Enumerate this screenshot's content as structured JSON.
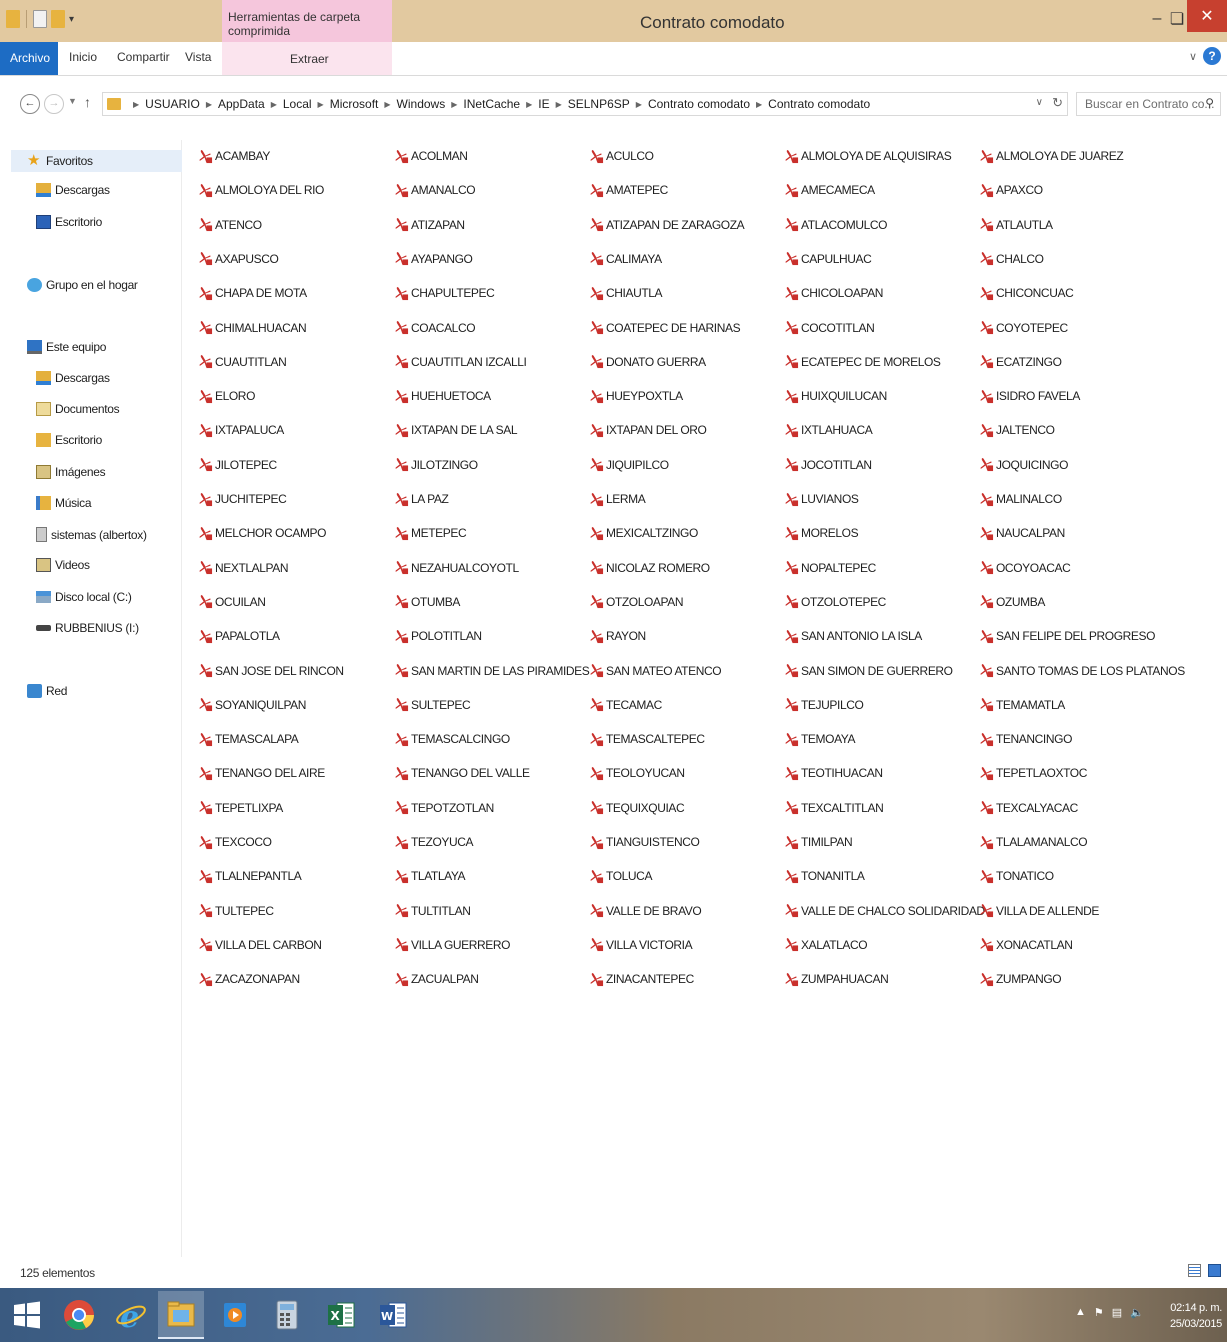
{
  "window": {
    "title": "Contrato comodato",
    "context_tab_header": "Herramientas de carpeta comprimida"
  },
  "ribbon": {
    "tabs": [
      "Archivo",
      "Inicio",
      "Compartir",
      "Vista"
    ],
    "context_tab": "Extraer"
  },
  "address": {
    "breadcrumbs": [
      "USUARIO",
      "AppData",
      "Local",
      "Microsoft",
      "Windows",
      "INetCache",
      "IE",
      "SELNP6SP",
      "Contrato comodato",
      "Contrato comodato"
    ],
    "search_placeholder": "Buscar en Contrato co..."
  },
  "navpane": {
    "favorites": "Favoritos",
    "fav_items": [
      "Descargas",
      "Escritorio"
    ],
    "homegroup": "Grupo en el hogar",
    "thispc": "Este equipo",
    "pc_items": [
      "Descargas",
      "Documentos",
      "Escritorio",
      "Imágenes",
      "Música",
      "sistemas (albertox)",
      "Videos",
      "Disco local (C:)",
      "RUBBENIUS (I:)"
    ],
    "network": "Red"
  },
  "files": [
    "ACAMBAY",
    "ACOLMAN",
    "ACULCO",
    "ALMOLOYA DE ALQUISIRAS",
    "ALMOLOYA DE JUAREZ",
    "ALMOLOYA DEL RIO",
    "AMANALCO",
    "AMATEPEC",
    "AMECAMECA",
    "APAXCO",
    "ATENCO",
    "ATIZAPAN",
    "ATIZAPAN DE ZARAGOZA",
    "ATLACOMULCO",
    "ATLAUTLA",
    "AXAPUSCO",
    "AYAPANGO",
    "CALIMAYA",
    "CAPULHUAC",
    "CHALCO",
    "CHAPA DE MOTA",
    "CHAPULTEPEC",
    "CHIAUTLA",
    "CHICOLOAPAN",
    "CHICONCUAC",
    "CHIMALHUACAN",
    "COACALCO",
    "COATEPEC DE HARINAS",
    "COCOTITLAN",
    "COYOTEPEC",
    "CUAUTITLAN",
    "CUAUTITLAN IZCALLI",
    "DONATO GUERRA",
    "ECATEPEC DE MORELOS",
    "ECATZINGO",
    "ELORO",
    "HUEHUETOCA",
    "HUEYPOXTLA",
    "HUIXQUILUCAN",
    "ISIDRO FAVELA",
    "IXTAPALUCA",
    "IXTAPAN DE LA SAL",
    "IXTAPAN DEL ORO",
    "IXTLAHUACA",
    "JALTENCO",
    "JILOTEPEC",
    "JILOTZINGO",
    "JIQUIPILCO",
    "JOCOTITLAN",
    "JOQUICINGO",
    "JUCHITEPEC",
    "LA PAZ",
    "LERMA",
    "LUVIANOS",
    "MALINALCO",
    "MELCHOR OCAMPO",
    "METEPEC",
    "MEXICALTZINGO",
    "MORELOS",
    "NAUCALPAN",
    "NEXTLALPAN",
    "NEZAHUALCOYOTL",
    "NICOLAZ ROMERO",
    "NOPALTEPEC",
    "OCOYOACAC",
    "OCUILAN",
    "OTUMBA",
    "OTZOLOAPAN",
    "OTZOLOTEPEC",
    "OZUMBA",
    "PAPALOTLA",
    "POLOTITLAN",
    "RAYON",
    "SAN ANTONIO LA ISLA",
    "SAN FELIPE DEL PROGRESO",
    "SAN JOSE DEL RINCON",
    "SAN MARTIN DE LAS PIRAMIDES",
    "SAN MATEO ATENCO",
    "SAN SIMON DE GUERRERO",
    "SANTO TOMAS DE LOS PLATANOS",
    "SOYANIQUILPAN",
    "SULTEPEC",
    "TECAMAC",
    "TEJUPILCO",
    "TEMAMATLA",
    "TEMASCALAPA",
    "TEMASCALCINGO",
    "TEMASCALTEPEC",
    "TEMOAYA",
    "TENANCINGO",
    "TENANGO DEL AIRE",
    "TENANGO DEL VALLE",
    "TEOLOYUCAN",
    "TEOTIHUACAN",
    "TEPETLAOXTOC",
    "TEPETLIXPA",
    "TEPOTZOTLAN",
    "TEQUIXQUIAC",
    "TEXCALTITLAN",
    "TEXCALYACAC",
    "TEXCOCO",
    "TEZOYUCA",
    "TIANGUISTENCO",
    "TIMILPAN",
    "TLALAMANALCO",
    "TLALNEPANTLA",
    "TLATLAYA",
    "TOLUCA",
    "TONANITLA",
    "TONATICO",
    "TULTEPEC",
    "TULTITLAN",
    "VALLE DE BRAVO",
    "VALLE DE CHALCO SOLIDARIDAD",
    "VILLA DE ALLENDE",
    "VILLA DEL CARBON",
    "VILLA GUERRERO",
    "VILLA VICTORIA",
    "XALATLACO",
    "XONACATLAN",
    "ZACAZONAPAN",
    "ZACUALPAN",
    "ZINACANTEPEC",
    "ZUMPAHUACAN",
    "ZUMPANGO"
  ],
  "status": {
    "count": "125 elementos"
  },
  "taskbar": {
    "time": "02:14 p. m.",
    "date": "25/03/2015"
  },
  "colors": {
    "titlebar": "#e2c9a0",
    "file_tab": "#1d6cc4",
    "context_tab": "#f5c6dc",
    "close_button": "#c7402f",
    "pdf_icon": "#c9302c"
  }
}
